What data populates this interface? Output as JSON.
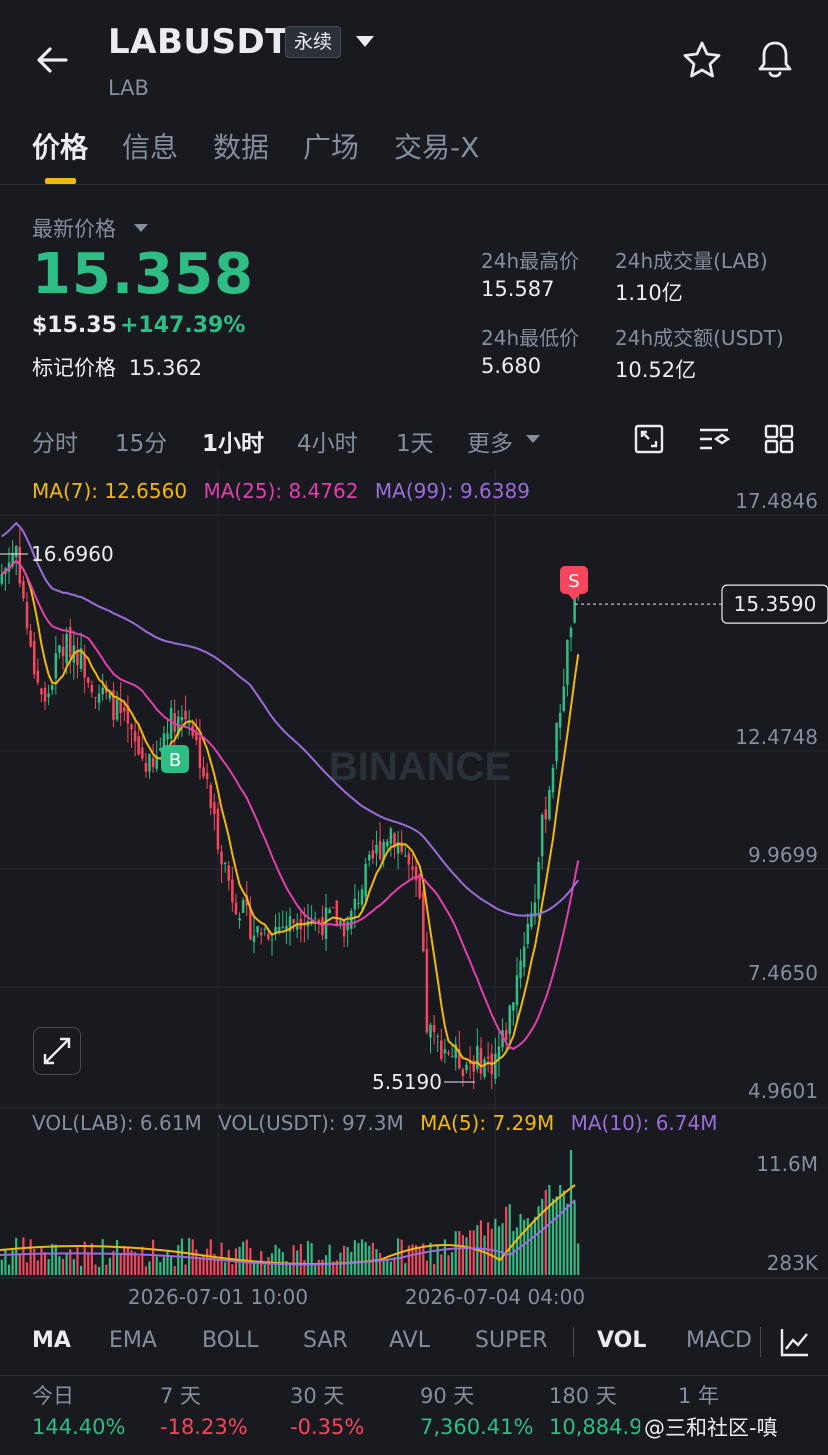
{
  "header": {
    "pair": "LABUSDT",
    "contract_badge": "永续",
    "base_asset": "LAB"
  },
  "tabs": [
    "价格",
    "信息",
    "数据",
    "广场",
    "交易-X"
  ],
  "price": {
    "last_label": "最新价格",
    "last": "15.358",
    "usd": "$15.35",
    "change": "+147.39%",
    "mark_label": "标记价格",
    "mark": "15.362"
  },
  "stats": {
    "high_label": "24h最高价",
    "high": "15.587",
    "vol_base_label": "24h成交量(LAB)",
    "vol_base": "1.10亿",
    "low_label": "24h最低价",
    "low": "5.680",
    "vol_quote_label": "24h成交额(USDT)",
    "vol_quote": "10.52亿"
  },
  "intervals": [
    "分时",
    "15分",
    "1小时",
    "4小时",
    "1天",
    "更多"
  ],
  "ma_legend": {
    "ma7": "MA(7): 12.6560",
    "ma25": "MA(25): 8.4762",
    "ma99": "MA(99): 9.6389"
  },
  "vol_legend": {
    "vol_base": "VOL(LAB): 6.61M",
    "vol_quote": "VOL(USDT): 97.3M",
    "ma5": "MA(5): 7.29M",
    "ma10": "MA(10): 6.74M"
  },
  "colors": {
    "up": "#2EBD85",
    "down": "#F6465D",
    "ma7": "#F0B90B",
    "ma25": "#E040AB",
    "ma99": "#9A6DD7",
    "accent": "#F0B90B"
  },
  "chart_data": {
    "type": "candlestick",
    "y_ticks": [
      "17.4846",
      "12.4748",
      "9.9699",
      "7.4650",
      "4.9601"
    ],
    "ylim": [
      4.9601,
      17.4846
    ],
    "x_ticks": [
      "2026-07-01 10:00",
      "2026-07-04 04:00"
    ],
    "current_price": "15.3590",
    "high_marker": "16.6960",
    "low_marker": "5.5190",
    "buy_marker": "B",
    "sell_marker": "S",
    "watermark": "BINANCE",
    "volume_ticks": [
      "11.6M",
      "283K"
    ],
    "ma_series": [
      "MA(7)",
      "MA(25)",
      "MA(99)"
    ]
  },
  "indicators": [
    "MA",
    "EMA",
    "BOLL",
    "SAR",
    "AVL",
    "SUPER",
    "VOL",
    "MACD"
  ],
  "performance": [
    {
      "label": "今日",
      "value": "144.40%",
      "dir": "up"
    },
    {
      "label": "7 天",
      "value": "-18.23%",
      "dir": "down"
    },
    {
      "label": "30 天",
      "value": "-0.35%",
      "dir": "down"
    },
    {
      "label": "90 天",
      "value": "7,360.41%",
      "dir": "up"
    },
    {
      "label": "180 天",
      "value": "10,884.9",
      "dir": "up"
    },
    {
      "label": "1 年",
      "value": "",
      "dir": "up"
    }
  ],
  "source_overlay": "@三和社区-嗔"
}
